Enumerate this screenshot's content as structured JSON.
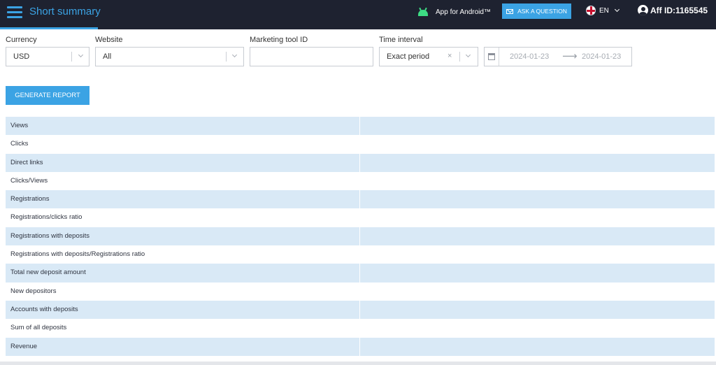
{
  "header": {
    "title": "Short summary",
    "android_label": "App for Android™",
    "ask_label": "ASK A QUESTION",
    "lang": "EN",
    "user": "Aff ID:1165545"
  },
  "filters": {
    "currency": {
      "label": "Currency",
      "value": "USD"
    },
    "website": {
      "label": "Website",
      "value": "All"
    },
    "marketing": {
      "label": "Marketing tool ID",
      "value": ""
    },
    "interval": {
      "label": "Time interval",
      "value": "Exact period"
    },
    "date_start": "2024-01-23",
    "date_end": "2024-01-23",
    "clear_glyph": "×",
    "arrow_glyph": "⟶"
  },
  "actions": {
    "generate_label": "GENERATE REPORT"
  },
  "table": {
    "rows": [
      "Views",
      "Clicks",
      "Direct links",
      "Clicks/Views",
      "Registrations",
      "Registrations/clicks ratio",
      "Registrations with deposits",
      "Registrations with deposits/Registrations ratio",
      "Total new deposit amount",
      "New depositors",
      "Accounts with deposits",
      "Sum of all deposits",
      "Revenue"
    ]
  },
  "colors": {
    "header_bg": "#1e2230",
    "accent": "#3ba3e4",
    "row_alt": "#d9e9f6"
  },
  "icons": [
    "menu-icon",
    "android-icon",
    "mail-icon",
    "uk-flag-icon",
    "chevron-down-icon",
    "user-icon",
    "calendar-icon",
    "clear-icon"
  ]
}
